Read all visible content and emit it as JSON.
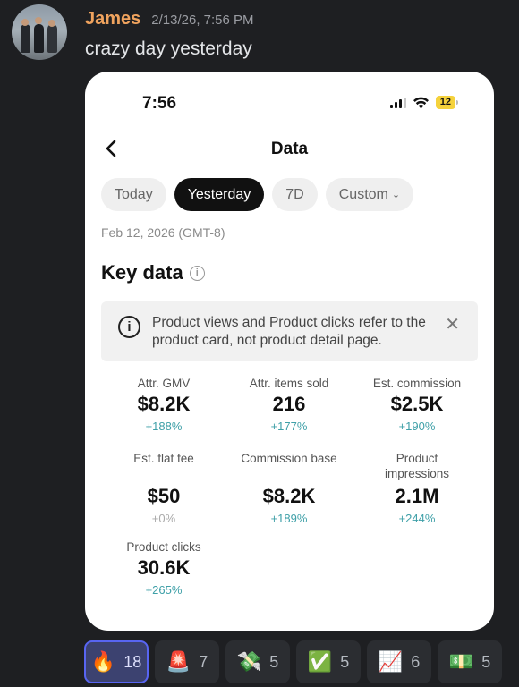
{
  "message": {
    "username": "James",
    "timestamp": "2/13/26, 7:56 PM",
    "text": "crazy day yesterday"
  },
  "screenshot": {
    "status_time": "7:56",
    "battery": "12",
    "page_title": "Data",
    "tabs": [
      "Today",
      "Yesterday",
      "7D",
      "Custom"
    ],
    "active_tab": "Yesterday",
    "date_label": "Feb 12, 2026 (GMT-8)",
    "section_title": "Key data",
    "notice_text": "Product views and Product clicks refer to the product card, not product detail page.",
    "metrics": [
      {
        "label": "Attr. GMV",
        "value": "$8.2K",
        "change": "+188%"
      },
      {
        "label": "Attr. items sold",
        "value": "216",
        "change": "+177%"
      },
      {
        "label": "Est. commission",
        "value": "$2.5K",
        "change": "+190%"
      },
      {
        "label": "Est. flat fee",
        "value": "$50",
        "change": "+0%"
      },
      {
        "label": "Commission base",
        "value": "$8.2K",
        "change": "+189%"
      },
      {
        "label": "Product impressions",
        "value": "2.1M",
        "change": "+244%"
      },
      {
        "label": "Product clicks",
        "value": "30.6K",
        "change": "+265%"
      }
    ]
  },
  "reactions": [
    {
      "emoji": "🔥",
      "count": "18",
      "active": true,
      "icon": "fire-icon"
    },
    {
      "emoji": "🚨",
      "count": "7",
      "icon": "siren-icon"
    },
    {
      "emoji": "💸",
      "count": "5",
      "icon": "money-wings-icon"
    },
    {
      "emoji": "✅",
      "count": "5",
      "icon": "check-mark-icon"
    },
    {
      "emoji": "📈",
      "count": "6",
      "icon": "chart-increasing-icon"
    },
    {
      "emoji": "💵",
      "count": "5",
      "icon": "dollar-banknote-icon"
    }
  ],
  "colors": {
    "username": "#f0a35e",
    "background": "#1e1f22",
    "change_positive": "#3fa0a8",
    "active_reaction_border": "#5865f2"
  }
}
